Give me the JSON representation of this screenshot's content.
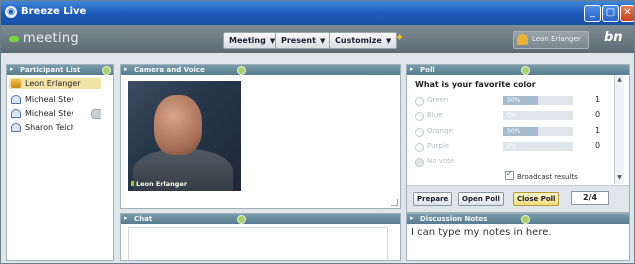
{
  "window": {
    "title": "Breeze Live",
    "app_icon": "breeze-logo-icon"
  },
  "toolbar": {
    "room_name": "meeting",
    "menus": [
      {
        "label": "Meeting"
      },
      {
        "label": "Present"
      },
      {
        "label": "Customize"
      }
    ],
    "user_name": "Leon Erlanger",
    "brand_logo": "bn"
  },
  "pods": {
    "participants": {
      "title": "Participant List",
      "items": [
        {
          "name": "Leon Erlanger",
          "role": "host",
          "selected": true
        },
        {
          "name": "Micheal Stevens",
          "role": "participant"
        },
        {
          "name": "Micheal Stevens",
          "role": "participant",
          "speaking": true
        },
        {
          "name": "Sharon Teicher",
          "role": "participant"
        }
      ]
    },
    "camera": {
      "title": "Camera and Voice",
      "caption": "Leon Erlanger"
    },
    "poll": {
      "title": "Poll",
      "question": "What is your favorite color",
      "options": [
        {
          "label": "Green",
          "percent_label": "50%",
          "percent": 50,
          "count": "1"
        },
        {
          "label": "Blue",
          "percent_label": "0%",
          "percent": 0,
          "count": "0"
        },
        {
          "label": "Orange",
          "percent_label": "50%",
          "percent": 50,
          "count": "1"
        },
        {
          "label": "Purple",
          "percent_label": "0%",
          "percent": 0,
          "count": "0"
        },
        {
          "label": "No vote",
          "percent_label": "",
          "percent": 0,
          "count": ""
        }
      ],
      "broadcast_label": "Broadcast results",
      "broadcast_checked": true,
      "buttons": {
        "prepare": "Prepare",
        "open": "Open Poll",
        "close": "Close Poll"
      },
      "page": "2/4"
    },
    "chat": {
      "title": "Chat"
    },
    "notes": {
      "title": "Discussion Notes",
      "text": "I can type my notes in here."
    }
  },
  "colors": {
    "accent": "#1c58b8",
    "pod_header": "#567c8f",
    "toolbar": "#6a7780",
    "selected": "#f2e3a5"
  }
}
